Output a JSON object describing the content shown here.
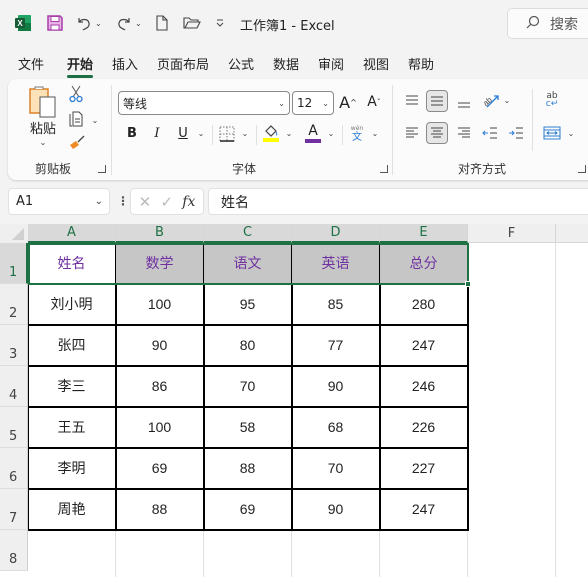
{
  "titlebar": {
    "app_icon": "excel-icon",
    "quick_access": [
      {
        "name": "save-icon"
      },
      {
        "name": "undo-icon"
      },
      {
        "name": "redo-icon"
      },
      {
        "name": "new-file-icon"
      },
      {
        "name": "open-folder-icon"
      },
      {
        "name": "customize-toolbar-icon"
      }
    ],
    "title": "工作簿1  -  Excel",
    "search_label": "搜索"
  },
  "menu": {
    "tabs": [
      "文件",
      "开始",
      "插入",
      "页面布局",
      "公式",
      "数据",
      "审阅",
      "视图",
      "帮助"
    ],
    "active": "开始"
  },
  "ribbon": {
    "clipboard": {
      "paste_label": "粘贴",
      "group_label": "剪贴板"
    },
    "font": {
      "font_name": "等线",
      "font_size": "12",
      "bold": "B",
      "italic": "I",
      "underline": "U",
      "grow": "A",
      "shrink": "A",
      "phonetic_top": "wén",
      "phonetic_bottom": "文",
      "font_color_letter": "A",
      "highlight_color": "#ffff00",
      "font_color": "#7030a0",
      "group_label": "字体"
    },
    "alignment": {
      "group_label": "对齐方式",
      "wrap_text": "ab"
    }
  },
  "formula_bar": {
    "name_box": "A1",
    "fx": "fx",
    "formula": "姓名"
  },
  "sheet": {
    "columns": [
      "A",
      "B",
      "C",
      "D",
      "E",
      "F"
    ],
    "rows": [
      "1",
      "2",
      "3",
      "4",
      "5",
      "6",
      "7",
      "8"
    ],
    "selected_cell": "A1",
    "header": [
      "姓名",
      "数学",
      "语文",
      "英语",
      "总分"
    ],
    "data": [
      [
        "刘小明",
        "100",
        "95",
        "85",
        "280"
      ],
      [
        "张四",
        "90",
        "80",
        "77",
        "247"
      ],
      [
        "李三",
        "86",
        "70",
        "90",
        "246"
      ],
      [
        "王五",
        "100",
        "58",
        "68",
        "226"
      ],
      [
        "李明",
        "69",
        "88",
        "70",
        "227"
      ],
      [
        "周艳",
        "88",
        "69",
        "90",
        "247"
      ]
    ],
    "colors": {
      "header_fill": "#c6c6c6",
      "header_text": "#7030a0",
      "selection": "#1e7145"
    }
  }
}
